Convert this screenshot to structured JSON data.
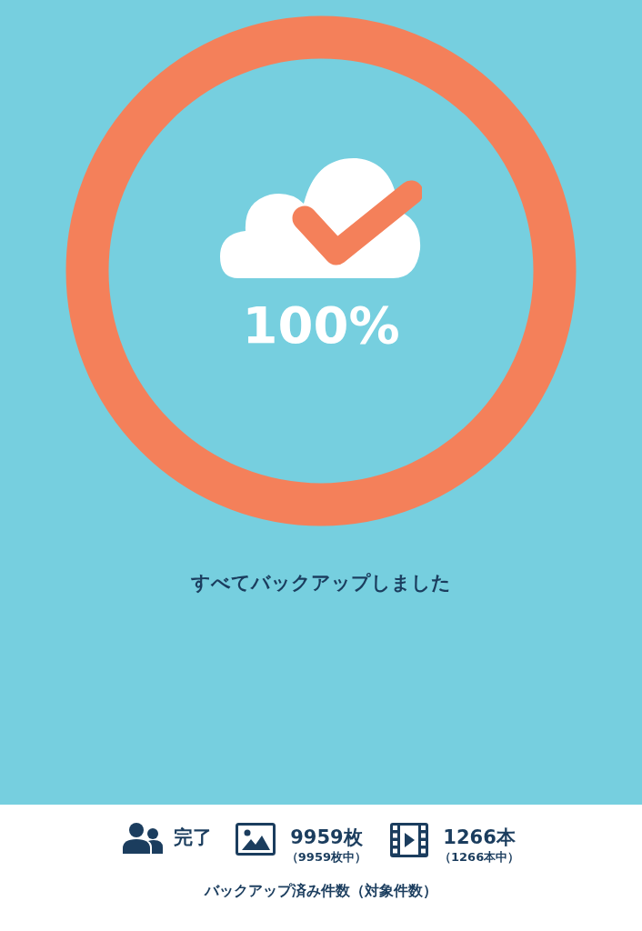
{
  "progress": {
    "level": 1,
    "percent": "100%",
    "complete": true
  },
  "message": "すべてバックアップしました",
  "stats": [
    {
      "kind": "people",
      "value": "完了"
    },
    {
      "kind": "image",
      "value": "9959枚",
      "sub": "（9959枚中）"
    },
    {
      "kind": "video",
      "value": "1266本",
      "sub": "（1266本中）"
    }
  ],
  "caption": "バックアップ済み件数（対象件数）"
}
